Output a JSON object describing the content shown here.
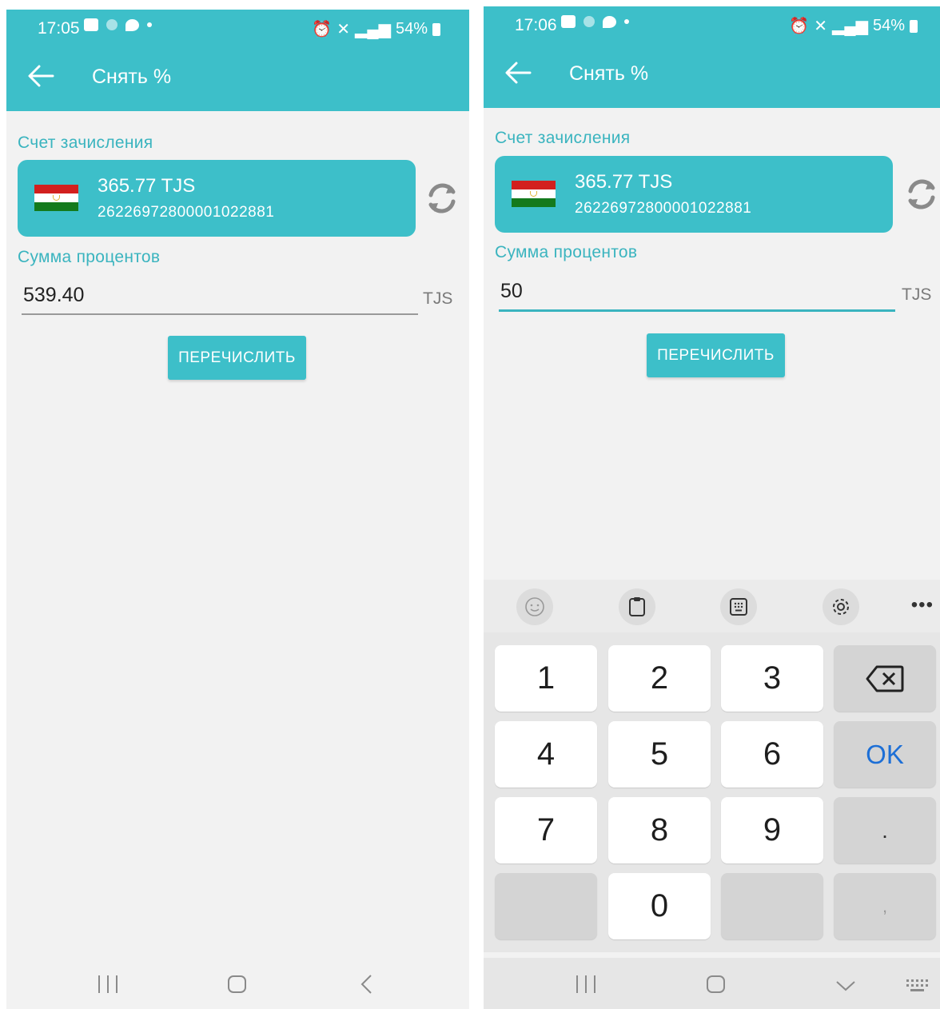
{
  "screens": [
    {
      "status": {
        "time": "17:05",
        "right": "54%"
      },
      "header": {
        "title": "Снять %"
      },
      "account_label": "Счет зачисления",
      "account": {
        "balance": "365.77 TJS",
        "number": "26226972800001022881"
      },
      "amount_label": "Сумма процентов",
      "amount_value": "539.40",
      "currency": "TJS",
      "button": "ПЕРЕЧИСЛИТЬ"
    },
    {
      "status": {
        "time": "17:06",
        "right": "54%"
      },
      "header": {
        "title": "Снять %"
      },
      "account_label": "Счет зачисления",
      "account": {
        "balance": "365.77 TJS",
        "number": "26226972800001022881"
      },
      "amount_label": "Сумма процентов",
      "amount_value": "50",
      "currency": "TJS",
      "button": "ПЕРЕЧИСЛИТЬ",
      "keyboard": {
        "keys": [
          "1",
          "2",
          "3",
          "4",
          "5",
          "6",
          "7",
          "8",
          "9",
          "0"
        ],
        "ok": "OK",
        "dot": ".",
        "comma": ","
      }
    }
  ],
  "colors": {
    "accent": "#3dbfc9",
    "label": "#3ab4bf",
    "background": "#f2f2f2"
  },
  "icons": [
    "back-arrow-icon",
    "refresh-icon",
    "flag-tajikistan-icon",
    "backspace-icon",
    "emoji-icon",
    "clipboard-icon",
    "keypad-icon",
    "settings-icon"
  ]
}
